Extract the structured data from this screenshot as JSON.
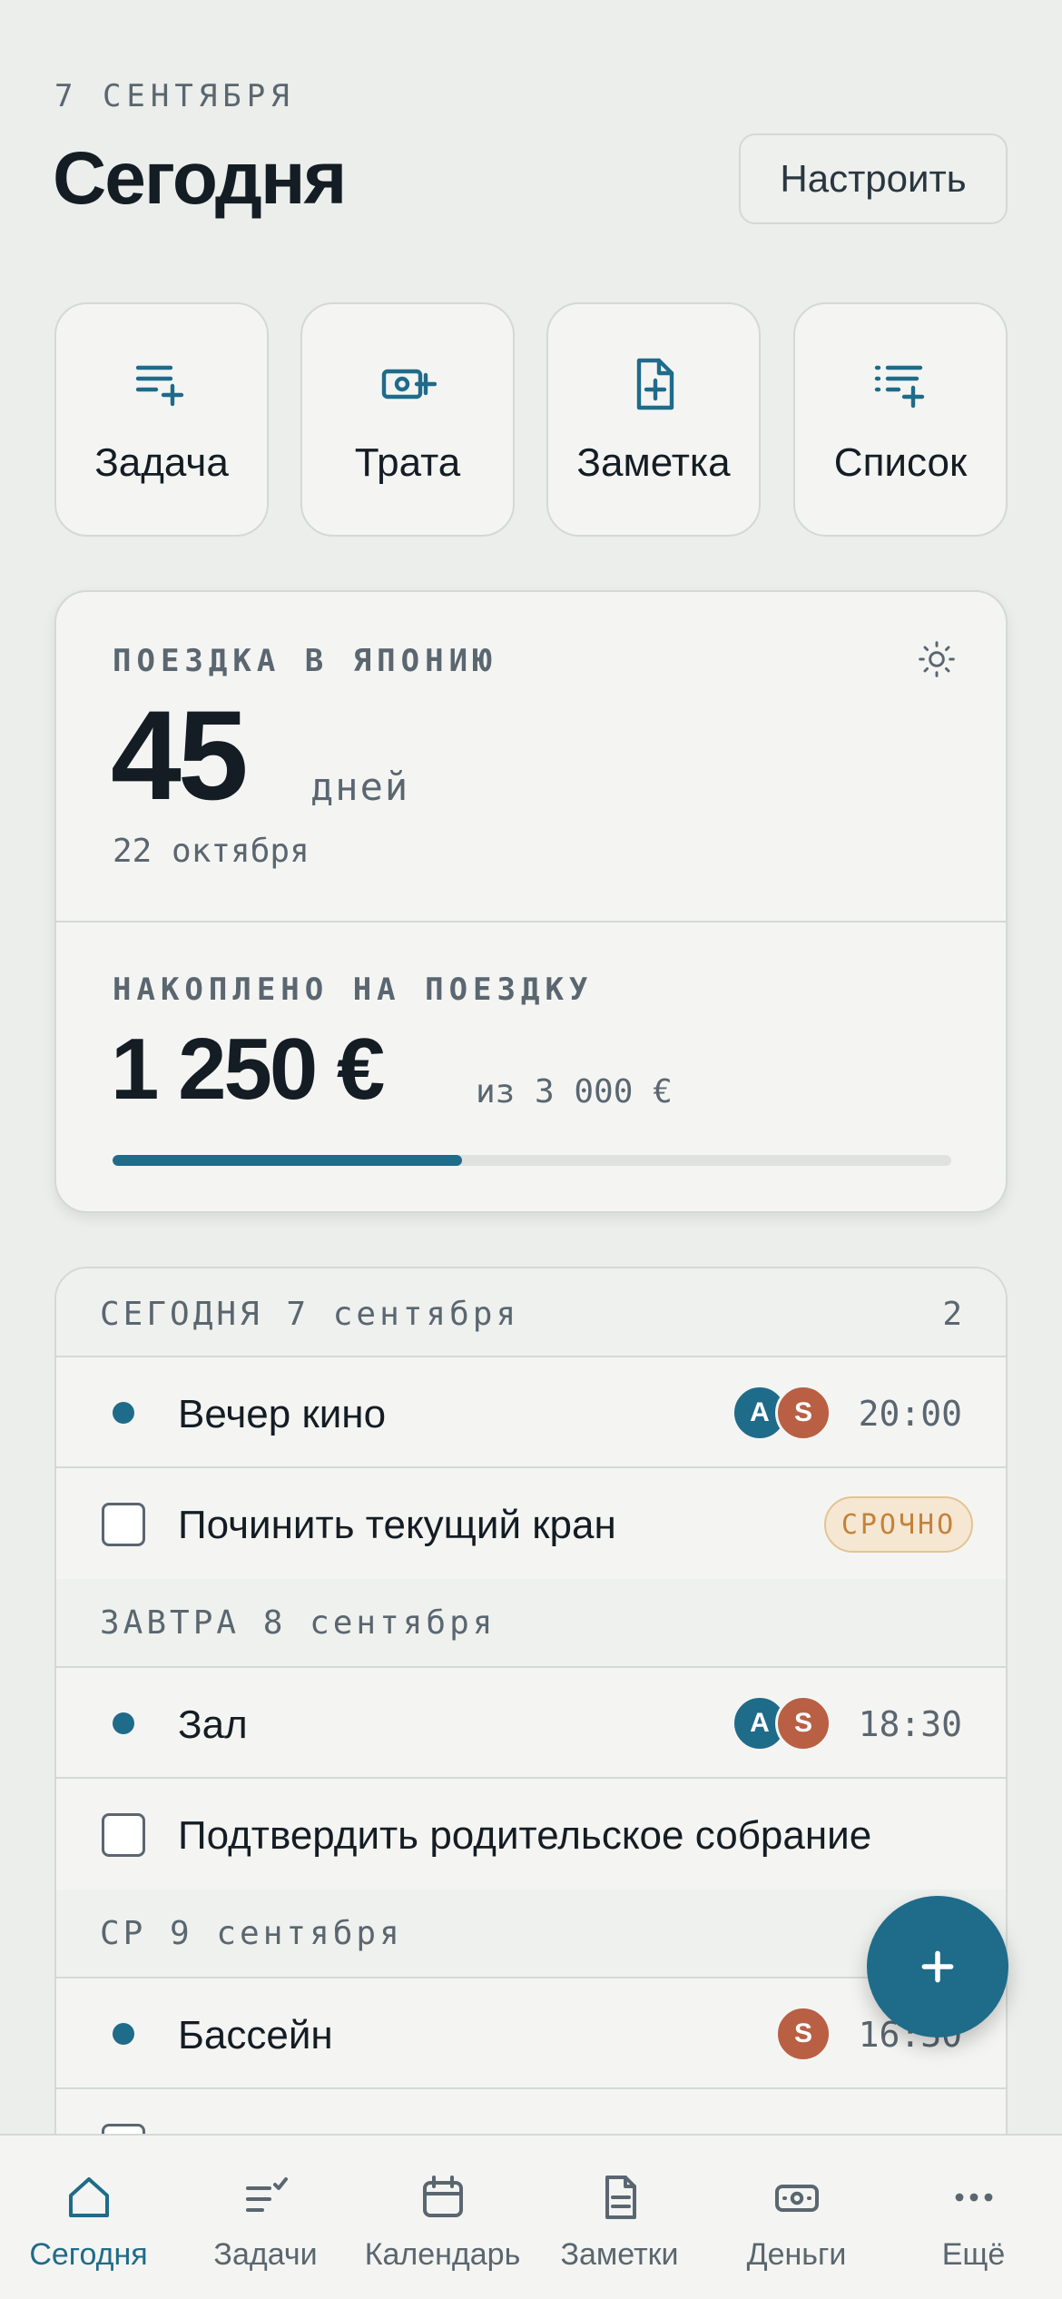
{
  "header": {
    "date": "7 СЕНТЯБРЯ",
    "title": "Сегодня",
    "customize_label": "Настроить"
  },
  "quick_actions": [
    {
      "label": "Задача",
      "icon": "add-task-icon"
    },
    {
      "label": "Трата",
      "icon": "add-expense-icon"
    },
    {
      "label": "Заметка",
      "icon": "add-note-icon"
    },
    {
      "label": "Список",
      "icon": "add-list-icon"
    }
  ],
  "countdown": {
    "label": "ПОЕЗДКА В ЯПОНИЮ",
    "days": "45",
    "days_unit": "дней",
    "date": "22 октября",
    "icon": "sun-icon"
  },
  "savings": {
    "label": "НАКОПЛЕНО НА ПОЕЗДКУ",
    "amount": "1 250 €",
    "goal": "из 3 000 €",
    "progress": 0.4167
  },
  "agenda": {
    "today_header": "СЕГОДНЯ 7 сентября",
    "today_count": "2",
    "today_items": [
      {
        "type": "event",
        "title": "Вечер кино",
        "time": "20:00",
        "avatars": [
          "A",
          "S"
        ]
      },
      {
        "type": "task",
        "title": "Починить текущий кран",
        "badge": "СРОЧНО"
      }
    ],
    "tomorrow_header": "ЗАВТРА 8 сентября",
    "tomorrow_items": [
      {
        "type": "event",
        "title": "Зал",
        "time": "18:30",
        "avatars": [
          "A",
          "S"
        ]
      },
      {
        "type": "task",
        "title": "Подтвердить родительское собрание"
      }
    ],
    "wed_header": "СР 9 сентября",
    "wed_items": [
      {
        "type": "event",
        "title": "Бассейн",
        "time": "16:30",
        "avatars": [
          "S"
        ]
      }
    ]
  },
  "fab_icon": "plus-icon",
  "nav": [
    {
      "label": "Сегодня",
      "icon": "home-icon",
      "active": true
    },
    {
      "label": "Задачи",
      "icon": "tasks-icon"
    },
    {
      "label": "Календарь",
      "icon": "calendar-icon"
    },
    {
      "label": "Заметки",
      "icon": "notes-icon"
    },
    {
      "label": "Деньги",
      "icon": "money-icon"
    },
    {
      "label": "Ещё",
      "icon": "more-icon"
    }
  ],
  "colors": {
    "accent": "#1f6b8a",
    "avatar_s": "#b85f44",
    "background": "#ebeeea",
    "urgent": "#c4823a"
  }
}
